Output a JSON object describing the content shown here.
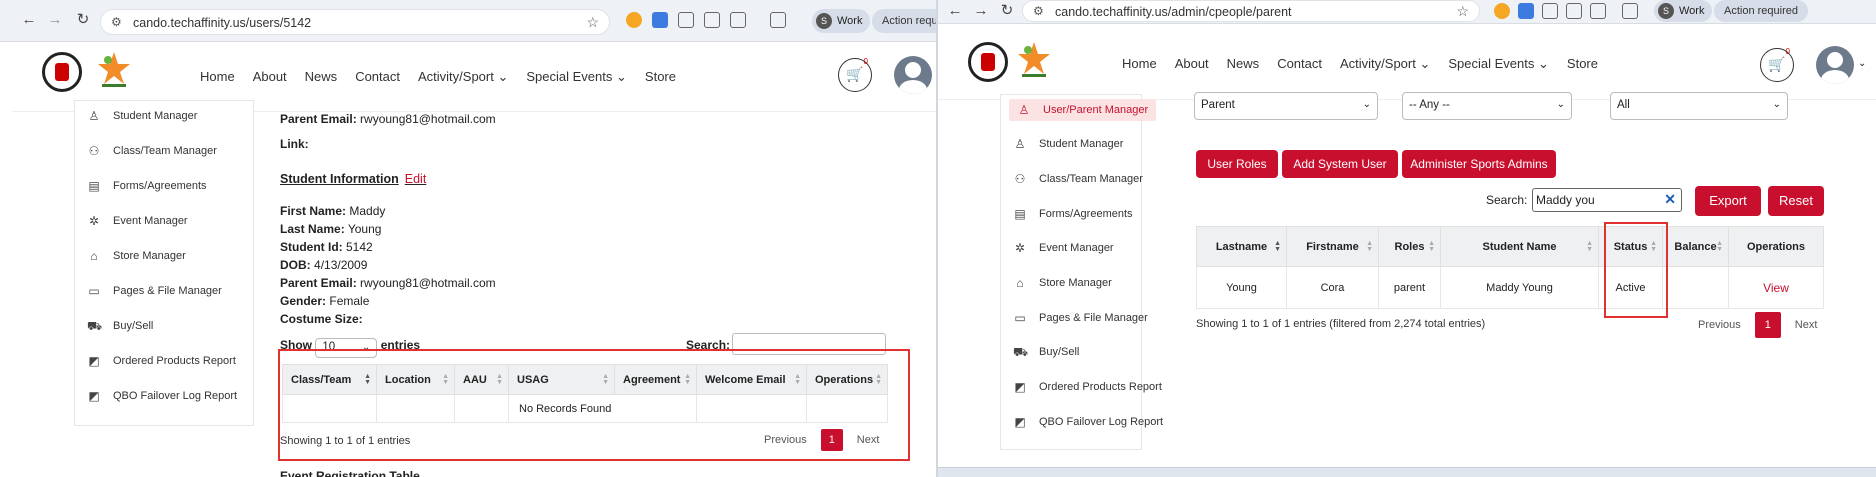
{
  "left": {
    "url": "cando.techaffinity.us/users/5142",
    "profile": "Work",
    "profile_initial": "S",
    "action_pill": "Action requir",
    "nav": [
      "Home",
      "About",
      "News",
      "Contact",
      "Activity/Sport",
      "Special Events",
      "Store"
    ],
    "cart_count": "0",
    "sidebar": [
      "Student Manager",
      "Class/Team Manager",
      "Forms/Agreements",
      "Event Manager",
      "Store Manager",
      "Pages & File Manager",
      "Buy/Sell",
      "Ordered Products Report",
      "QBO Failover Log Report"
    ],
    "parent_email_label": "Parent Email:",
    "parent_email_value": "rwyoung81@hotmail.com",
    "link_label": "Link:",
    "student_info_title": "Student Information",
    "edit_label": "Edit",
    "fields": [
      {
        "label": "First Name:",
        "value": "Maddy"
      },
      {
        "label": "Last Name:",
        "value": "Young"
      },
      {
        "label": "Student Id:",
        "value": "5142"
      },
      {
        "label": "DOB:",
        "value": "4/13/2009"
      },
      {
        "label": "Parent Email:",
        "value": "rwyoung81@hotmail.com"
      },
      {
        "label": "Gender:",
        "value": "Female"
      },
      {
        "label": "Costume Size:",
        "value": ""
      }
    ],
    "show_label": "Show",
    "entries_select": "10",
    "entries_label": "entries",
    "search_label": "Search:",
    "table_headers": [
      "Class/Team",
      "Location",
      "AAU",
      "USAG",
      "Agreement",
      "Welcome Email",
      "Operations"
    ],
    "no_records": "No Records Found",
    "showing": "Showing 1 to 1 of 1 entries",
    "previous": "Previous",
    "page": "1",
    "next": "Next",
    "event_reg_title": "Event Registration Table"
  },
  "right": {
    "url": "cando.techaffinity.us/admin/cpeople/parent",
    "profile": "Work",
    "profile_initial": "S",
    "action_pill": "Action required",
    "nav": [
      "Home",
      "About",
      "News",
      "Contact",
      "Activity/Sport",
      "Special Events",
      "Store"
    ],
    "cart_count": "0",
    "sidebar_active": "User/Parent Manager",
    "sidebar": [
      "Student Manager",
      "Class/Team Manager",
      "Forms/Agreements",
      "Event Manager",
      "Store Manager",
      "Pages & File Manager",
      "Buy/Sell",
      "Ordered Products Report",
      "QBO Failover Log Report"
    ],
    "filter_role": "Parent",
    "filter_any": "-- Any --",
    "filter_all": "All",
    "btn_user_roles": "User Roles",
    "btn_add_system_user": "Add System User",
    "btn_admin_sports": "Administer Sports Admins",
    "search_label": "Search:",
    "search_value": "Maddy you",
    "btn_export": "Export",
    "btn_reset": "Reset",
    "table_headers": [
      "Lastname",
      "Firstname",
      "Roles",
      "Student Name",
      "Status",
      "Balance",
      "Operations"
    ],
    "row": {
      "lastname": "Young",
      "firstname": "Cora",
      "roles": "parent",
      "student": "Maddy Young",
      "status": "Active",
      "balance": "",
      "op": "View"
    },
    "showing": "Showing 1 to 1 of 1 entries (filtered from 2,274 total entries)",
    "previous": "Previous",
    "page": "1",
    "next": "Next"
  },
  "colors": {
    "brand_red": "#c8102e",
    "highlight": "#e03030"
  }
}
